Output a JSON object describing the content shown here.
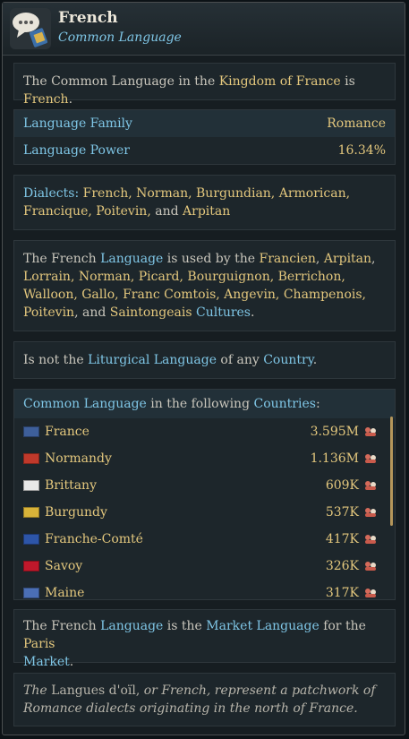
{
  "header": {
    "title": "French",
    "subtitle": "Common Language",
    "icon": "speech-bubble-icon"
  },
  "intro": {
    "p1": "The Common Language in the ",
    "kingdom": "Kingdom of France",
    "p2": " is ",
    "lang": "French",
    "p3": "."
  },
  "stats": {
    "family_label": "Language Family",
    "family_value": "Romance",
    "power_label": "Language Power",
    "power_value": "16.34%"
  },
  "dialects": {
    "label": "Dialects:",
    "line1": "French, Norman, Burgundian, Armorican,",
    "line2_a": "Francique, Poitevin,",
    "line2_and": " and ",
    "line2_b": "Arpitan"
  },
  "cultures": {
    "l1_a": "The French ",
    "l1_b": "Language",
    "l1_c": " is used by the ",
    "l1_d": "Francien",
    "l1_e": ", ",
    "l1_f": "Arpitan",
    "l1_g": ",",
    "l2": "Lorrain, Norman, Picard, Bourguignon, Berrichon,",
    "l3": "Walloon, Gallo, Franc Comtois, Angevin, Champenois,",
    "l4_a": "Poitevin",
    "l4_b": ", and ",
    "l4_c": "Saintongeais",
    "l4_d": " Cultures",
    "l4_e": "."
  },
  "liturgical": {
    "a": "Is not the ",
    "b": "Liturgical Language",
    "c": " of any ",
    "d": "Country",
    "e": "."
  },
  "countries": {
    "h_a": "Common Language",
    "h_b": " in the following ",
    "h_c": "Countries",
    "h_d": ":",
    "list": [
      {
        "name": "France",
        "value": "3.595M",
        "flag": "#3e5f9a"
      },
      {
        "name": "Normandy",
        "value": "1.136M",
        "flag": "#c0392b"
      },
      {
        "name": "Brittany",
        "value": "609K",
        "flag": "#e8e8e8"
      },
      {
        "name": "Burgundy",
        "value": "537K",
        "flag": "#d8b339"
      },
      {
        "name": "Franche-Comté",
        "value": "417K",
        "flag": "#2d55a8"
      },
      {
        "name": "Savoy",
        "value": "326K",
        "flag": "#c0182b"
      },
      {
        "name": "Maine",
        "value": "317K",
        "flag": "#4b6fb5"
      }
    ]
  },
  "market": {
    "a": "The French ",
    "b": "Language",
    "c": " is the ",
    "d": "Market Language",
    "e": " for the ",
    "f": "Paris",
    "g": "Market",
    "h": "."
  },
  "flavor": {
    "a": "The",
    "b": " Langues d'oïl, ",
    "c": "or French, represent a patchwork of",
    "d": "Romance dialects originating in the north of France."
  }
}
